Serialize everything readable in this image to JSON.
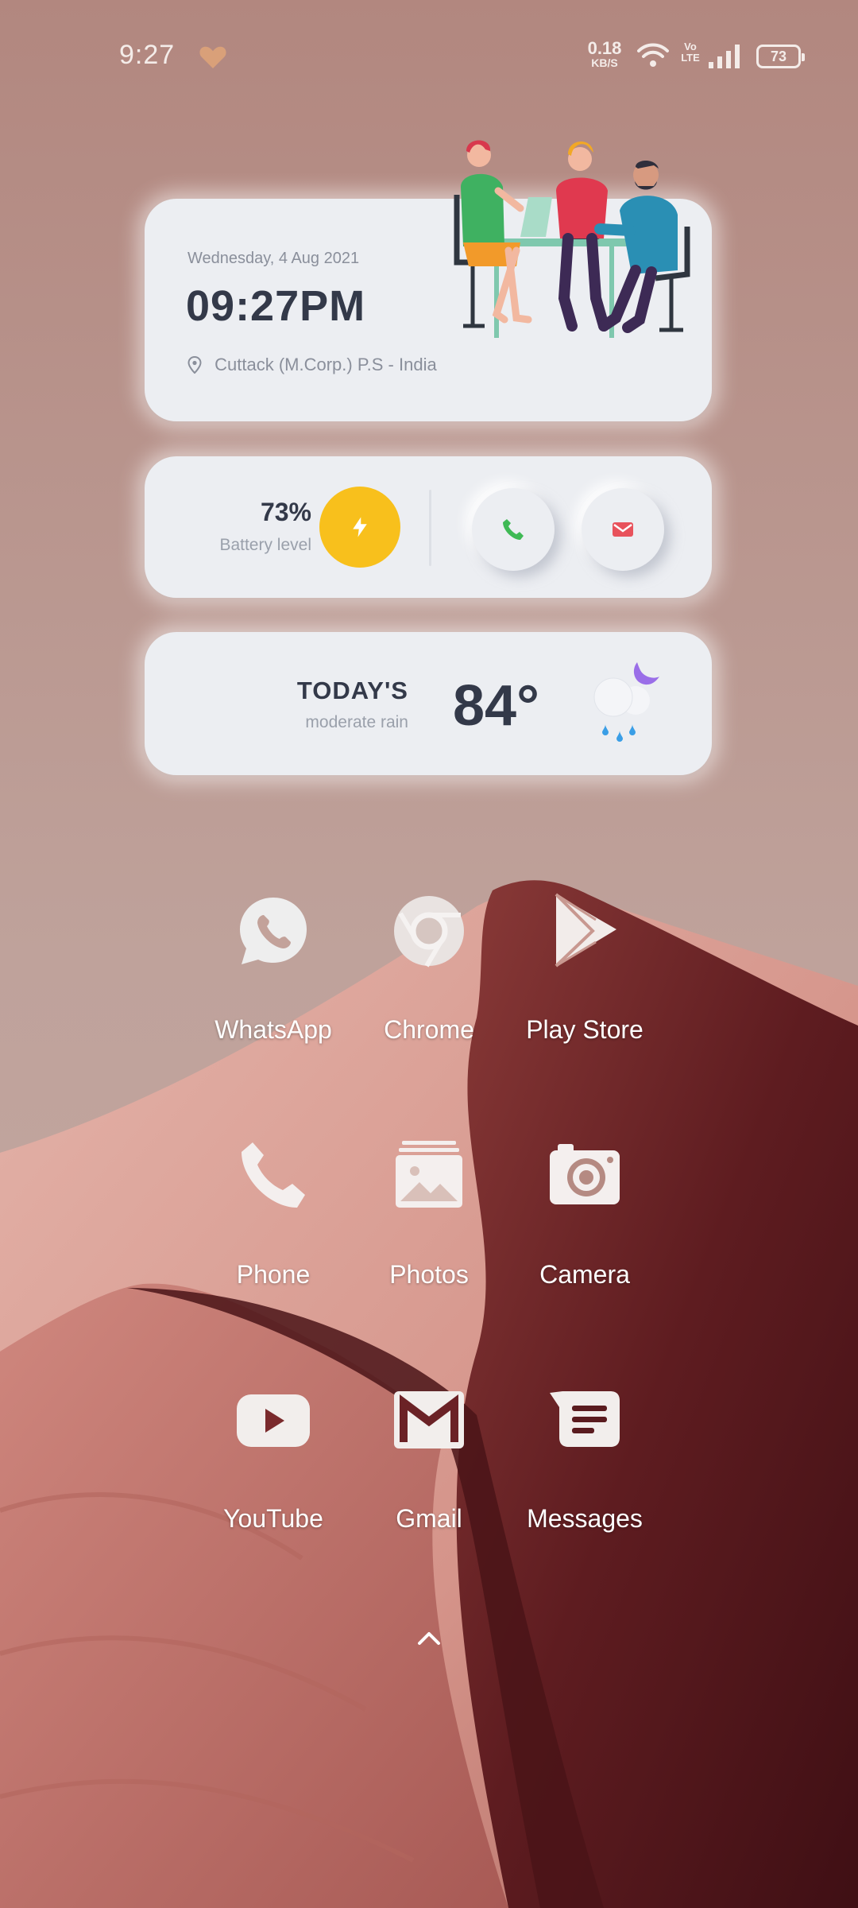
{
  "status_bar": {
    "time": "9:27",
    "net_speed_value": "0.18",
    "net_speed_unit": "KB/S",
    "volte_top": "Vo",
    "volte_bottom": "LTE",
    "battery": "73",
    "icons": [
      "heart-icon",
      "wifi-icon",
      "signal-icon",
      "battery-icon"
    ]
  },
  "clock_widget": {
    "date": "Wednesday, 4 Aug 2021",
    "time": "09:27PM",
    "location": "Cuttack (M.Corp.) P.S - India"
  },
  "battery_widget": {
    "level": "73%",
    "label": "Battery level",
    "level_fraction": 0.73,
    "accent_color": "#f8c01c"
  },
  "weather_widget": {
    "title": "TODAY'S",
    "condition": "moderate rain",
    "temperature": "84°"
  },
  "apps": [
    {
      "label": "WhatsApp",
      "icon": "whatsapp-icon"
    },
    {
      "label": "Chrome",
      "icon": "chrome-icon"
    },
    {
      "label": "Play Store",
      "icon": "play-store-icon"
    },
    {
      "label": "Phone",
      "icon": "phone-icon"
    },
    {
      "label": "Photos",
      "icon": "photos-icon"
    },
    {
      "label": "Camera",
      "icon": "camera-icon"
    },
    {
      "label": "YouTube",
      "icon": "youtube-icon"
    },
    {
      "label": "Gmail",
      "icon": "gmail-icon"
    },
    {
      "label": "Messages",
      "icon": "messages-icon"
    }
  ],
  "colors": {
    "card_background": "#eceef2",
    "text_dark": "#333949",
    "call_green": "#3fb955",
    "mail_red": "#e8525c"
  }
}
